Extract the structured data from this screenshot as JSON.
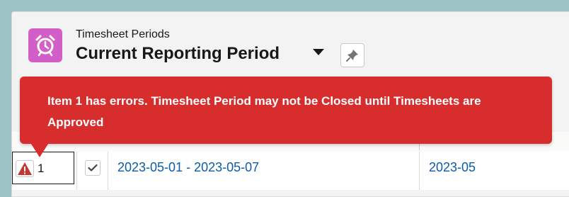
{
  "header": {
    "object_label": "Timesheet Periods",
    "view_title": "Current Reporting Period",
    "icon": "alarm-clock-icon",
    "accent_color": "#d25fc8"
  },
  "error": {
    "message": "Item 1 has errors. Timesheet Period may not be Closed until Timesheets are Approved",
    "color": "#d82d2d"
  },
  "table": {
    "rows": [
      {
        "number": "1",
        "checked": true,
        "period_name": "2023-05-01 - 2023-05-07",
        "month": "2023-05"
      }
    ]
  }
}
